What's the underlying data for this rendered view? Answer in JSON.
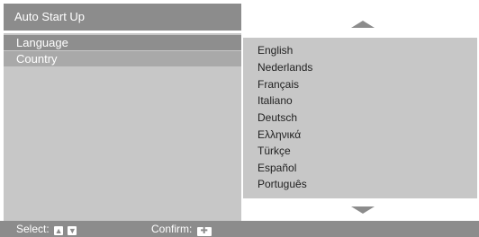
{
  "panel": {
    "title": "Auto Start Up",
    "menu": [
      {
        "label": "Language"
      },
      {
        "label": "Country"
      }
    ]
  },
  "options": [
    "English",
    "Nederlands",
    "Français",
    "Italiano",
    "Deutsch",
    "Ελληνικά",
    "Türkçe",
    "Español",
    "Português"
  ],
  "footer": {
    "select_label": "Select:",
    "confirm_label": "Confirm:",
    "icons": [
      "arrow-up-key-icon",
      "arrow-down-key-icon",
      "enter-key-icon"
    ]
  },
  "colors": {
    "header": "#8c8c8c",
    "panel": "#c7c7c7",
    "selected": "#8e8e8e"
  }
}
